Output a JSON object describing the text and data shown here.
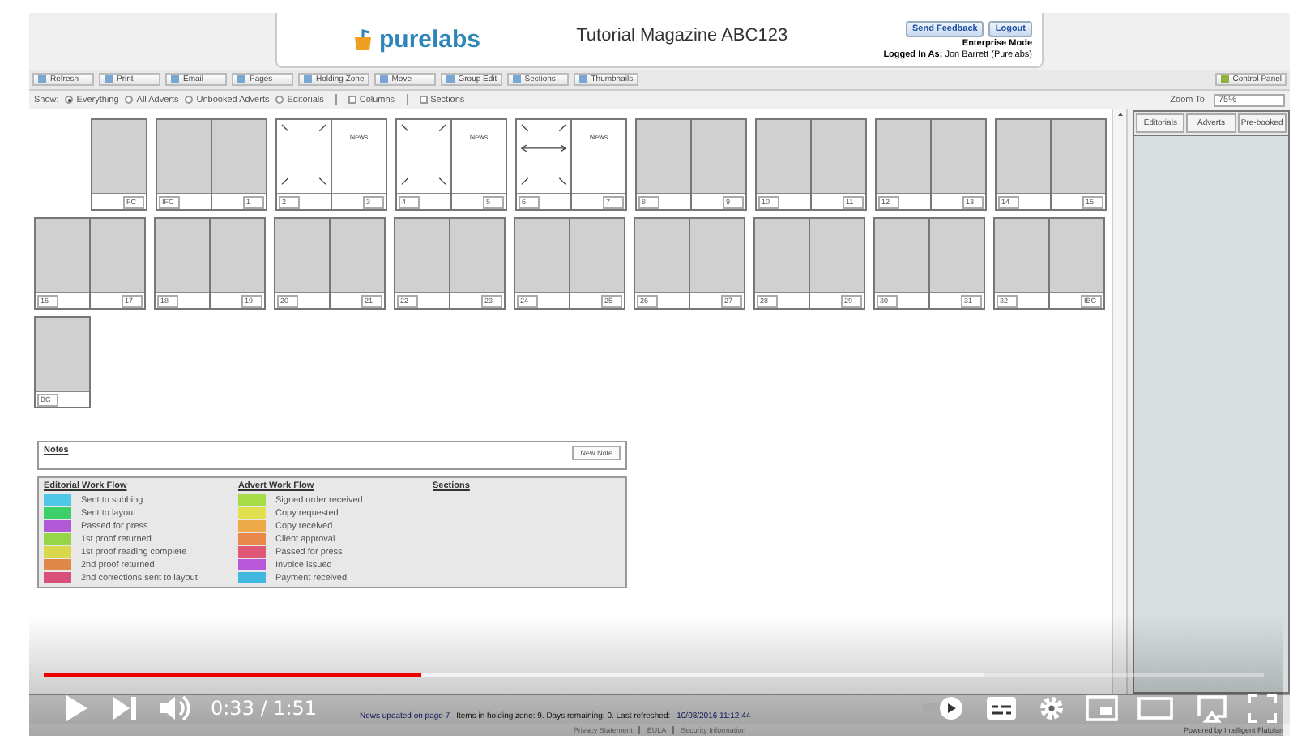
{
  "header": {
    "logo": "purelabs",
    "title": "Tutorial Magazine ABC123",
    "buttons": [
      "Send Feedback",
      "Logout"
    ],
    "mode": "Enterprise Mode",
    "login_label": "Logged In As:",
    "login_user": "Jon Barrett (Purelabs)"
  },
  "toolbar": {
    "buttons": [
      "Refresh",
      "Print",
      "Email",
      "Pages",
      "Holding Zone",
      "Move",
      "Group Edit",
      "Sections",
      "Thumbnails"
    ],
    "control_panel": "Control Panel"
  },
  "filter": {
    "label": "Show:",
    "radios": [
      {
        "label": "Everything",
        "selected": true
      },
      {
        "label": "All Adverts",
        "selected": false
      },
      {
        "label": "Unbooked Adverts",
        "selected": false
      },
      {
        "label": "Editorials",
        "selected": false
      }
    ],
    "checkboxes": [
      {
        "label": "Columns",
        "checked": false
      },
      {
        "label": "Sections",
        "checked": false
      }
    ],
    "zoom_label": "Zoom To:",
    "zoom": "75%"
  },
  "rows": [
    [
      {
        "recto": true,
        "pages": [
          {
            "number": "FC",
            "kind": "blank"
          }
        ]
      },
      {
        "pages": [
          {
            "number": "IFC",
            "kind": "blank"
          },
          {
            "number": "1",
            "kind": "blank"
          }
        ]
      },
      {
        "pages": [
          {
            "number": "2",
            "kind": "empty"
          },
          {
            "number": "3",
            "kind": "editorial",
            "text": "News"
          }
        ]
      },
      {
        "pages": [
          {
            "number": "4",
            "kind": "empty"
          },
          {
            "number": "5",
            "kind": "editorial",
            "text": "News"
          }
        ]
      },
      {
        "pages": [
          {
            "number": "6",
            "kind": "split"
          },
          {
            "number": "7",
            "kind": "editorial",
            "text": "News"
          }
        ]
      },
      {
        "pages": [
          {
            "number": "8",
            "kind": "blank"
          },
          {
            "number": "9",
            "kind": "blank"
          }
        ]
      },
      {
        "pages": [
          {
            "number": "10",
            "kind": "blank"
          },
          {
            "number": "11",
            "kind": "blank"
          }
        ]
      },
      {
        "pages": [
          {
            "number": "12",
            "kind": "blank"
          },
          {
            "number": "13",
            "kind": "blank"
          }
        ]
      },
      {
        "pages": [
          {
            "number": "14",
            "kind": "blank"
          },
          {
            "number": "15",
            "kind": "blank"
          }
        ]
      }
    ],
    [
      {
        "pages": [
          {
            "number": "16",
            "kind": "blank"
          },
          {
            "number": "17",
            "kind": "blank"
          }
        ]
      },
      {
        "pages": [
          {
            "number": "18",
            "kind": "blank"
          },
          {
            "number": "19",
            "kind": "blank"
          }
        ]
      },
      {
        "pages": [
          {
            "number": "20",
            "kind": "blank"
          },
          {
            "number": "21",
            "kind": "blank"
          }
        ]
      },
      {
        "pages": [
          {
            "number": "22",
            "kind": "blank"
          },
          {
            "number": "23",
            "kind": "blank"
          }
        ]
      },
      {
        "pages": [
          {
            "number": "24",
            "kind": "blank"
          },
          {
            "number": "25",
            "kind": "blank"
          }
        ]
      },
      {
        "pages": [
          {
            "number": "26",
            "kind": "blank"
          },
          {
            "number": "27",
            "kind": "blank"
          }
        ]
      },
      {
        "pages": [
          {
            "number": "28",
            "kind": "blank"
          },
          {
            "number": "29",
            "kind": "blank"
          }
        ]
      },
      {
        "pages": [
          {
            "number": "30",
            "kind": "blank"
          },
          {
            "number": "31",
            "kind": "blank"
          }
        ]
      },
      {
        "pages": [
          {
            "number": "32",
            "kind": "blank"
          },
          {
            "number": "IBC",
            "kind": "blank"
          }
        ]
      }
    ],
    [
      {
        "recto": false,
        "pages": [
          {
            "number": "BC",
            "kind": "blank"
          }
        ]
      }
    ]
  ],
  "side_panel": {
    "tabs": [
      {
        "label": "Editorials",
        "selected": false
      },
      {
        "label": "Adverts",
        "selected": false
      },
      {
        "label": "Pre-booked",
        "selected": false
      }
    ]
  },
  "notes": {
    "title": "Notes",
    "button": "New Note"
  },
  "legend": [
    {
      "title": "Editorial Work Flow",
      "items": [
        {
          "label": "Sent to subbing",
          "color": "#4fc8e8"
        },
        {
          "label": "Sent to layout",
          "color": "#3ccf6a"
        },
        {
          "label": "Passed for press",
          "color": "#b05ad8"
        },
        {
          "label": "1st proof returned",
          "color": "#96d448"
        },
        {
          "label": "1st proof reading complete",
          "color": "#d8d84a"
        },
        {
          "label": "2nd proof returned",
          "color": "#e0884a"
        },
        {
          "label": "2nd corrections sent to layout",
          "color": "#d8507a"
        }
      ]
    },
    {
      "title": "Advert Work Flow",
      "items": [
        {
          "label": "Signed order received",
          "color": "#a6dc48"
        },
        {
          "label": "Copy requested",
          "color": "#e0e050"
        },
        {
          "label": "Copy received",
          "color": "#eeaa48"
        },
        {
          "label": "Client approval",
          "color": "#e8884a"
        },
        {
          "label": "Passed for press",
          "color": "#e05878"
        },
        {
          "label": "Invoice issued",
          "color": "#b858d8"
        },
        {
          "label": "Payment received",
          "color": "#40b8e0"
        }
      ]
    },
    {
      "title": "Sections"
    }
  ],
  "status_bar": {
    "log_text": "News updated on page 7",
    "stats": "Items in holding zone: 9. Days remaining: 0. Last refreshed:",
    "refreshed": "10/08/2016 11:12:44"
  },
  "footer": {
    "links": [
      "Privacy Statement",
      "EULA",
      "Security Information"
    ],
    "powered": "Powered by Intelligent Flatplan"
  },
  "player": {
    "progress": {
      "level": 0.31
    },
    "buffered": {
      "level": 0.77
    },
    "time": "0:33 / 1:51"
  }
}
